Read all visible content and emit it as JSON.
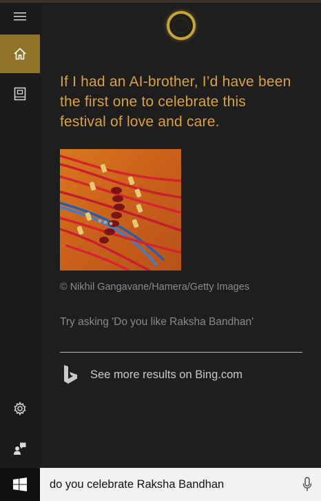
{
  "cortana": {
    "headline": "If I had an AI-brother, I’d have been the first one to celebrate this festival of love and care.",
    "image_credit": "© Nikhil Gangavane/Hamera/Getty Images",
    "suggestion": "Try asking 'Do you like Raksha Bandhan'",
    "bing_link": "See more results on Bing.com"
  },
  "rail": {
    "items": [
      {
        "icon": "hamburger-menu-icon"
      },
      {
        "icon": "home-icon",
        "active": true
      },
      {
        "icon": "notebook-icon"
      },
      {
        "icon": "settings-gear-icon"
      },
      {
        "icon": "feedback-icon"
      }
    ]
  },
  "taskbar": {
    "search_value": "do you celebrate Raksha Bandhan",
    "start_icon": "windows-logo-icon",
    "mic_icon": "microphone-icon"
  },
  "colors": {
    "accent": "#d9a33a",
    "active_rail": "#8f7428",
    "panel_bg": "#1e1e1e"
  }
}
